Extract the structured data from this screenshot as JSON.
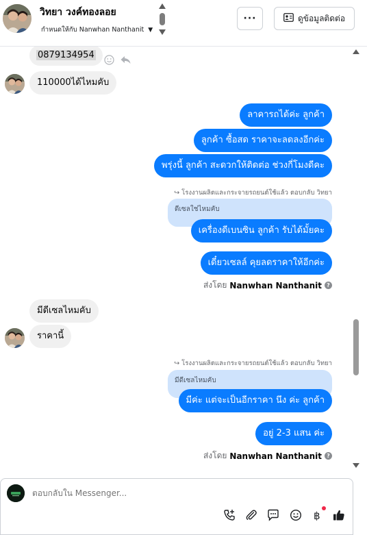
{
  "header": {
    "contact_name": "วิทยา วงค์ทองลอย",
    "assigned_to": "กำหนดให้กับ Nanwhan Nanthanit",
    "more_label": "···",
    "view_contact_label": "ดูข้อมูลติดต่อ"
  },
  "messages": {
    "phone": "0879134954",
    "in_price_question": "110000ได้ไหมคับ",
    "out_1": "ลาคารถได้ค่ะ  ลูกค้า",
    "out_2": "ลูกค้า ซื้อสด ราคาจะลดลงอีกค่ะ",
    "out_3": "พรุ่งนี้ ลูกค้า สะดวกให้ติดต่อ ช่วงกี่โมงดีคะ",
    "reply_meta_1": "โรงงานผลิตและกระจายรถยนต์ใช้แล้ว ตอบกลับ วิทยา",
    "quote_1": "ดีเซลใช่ไหมคับ",
    "out_4": "เครื่องดีเบนซิน ลูกค้า รับได้มั้ยคะ",
    "out_5": "เดี๋ยวเซลล์ คุยลดราคาให้อีกค่ะ",
    "sent_by_label_1": "ส่งโดย",
    "sent_by_name_1": "Nanwhan Nanthanit",
    "in_diesel_question": "มีดีเซลไหมคับ",
    "in_this_price": "ราคานี้",
    "reply_meta_2": "โรงงานผลิตและกระจายรถยนต์ใช้แล้ว ตอบกลับ วิทยา",
    "quote_2": "มีดีเซลไหมคับ",
    "out_6": "มีค่ะ แต่จะเป็นอีกราคา นึง ค่ะ  ลูกค้า",
    "out_7": "อยู่ 2-3 แสน ค่ะ",
    "sent_by_label_2": "ส่งโดย",
    "sent_by_name_2": "Nanwhan Nanthanit"
  },
  "composer": {
    "placeholder": "ตอบกลับใน Messenger..."
  },
  "colors": {
    "outgoing_bubble": "#0a7cff",
    "incoming_bubble": "#f0f0f0",
    "quote_bubble": "#cfe3fc",
    "icon_dark": "#1c1e21",
    "notification_dot": "#f02849"
  },
  "icons": {
    "more": "ellipsis-icon",
    "contact_card": "contact-card-icon",
    "dropdown": "caret-down-icon",
    "emoji_react": "smiley-icon",
    "reply": "reply-arrow-icon",
    "call": "phone-plus-icon",
    "attach": "paperclip-icon",
    "saved_replies": "chat-bubble-icon",
    "emoji": "emoji-icon",
    "payment": "baht-icon",
    "like": "thumbs-up-icon"
  }
}
